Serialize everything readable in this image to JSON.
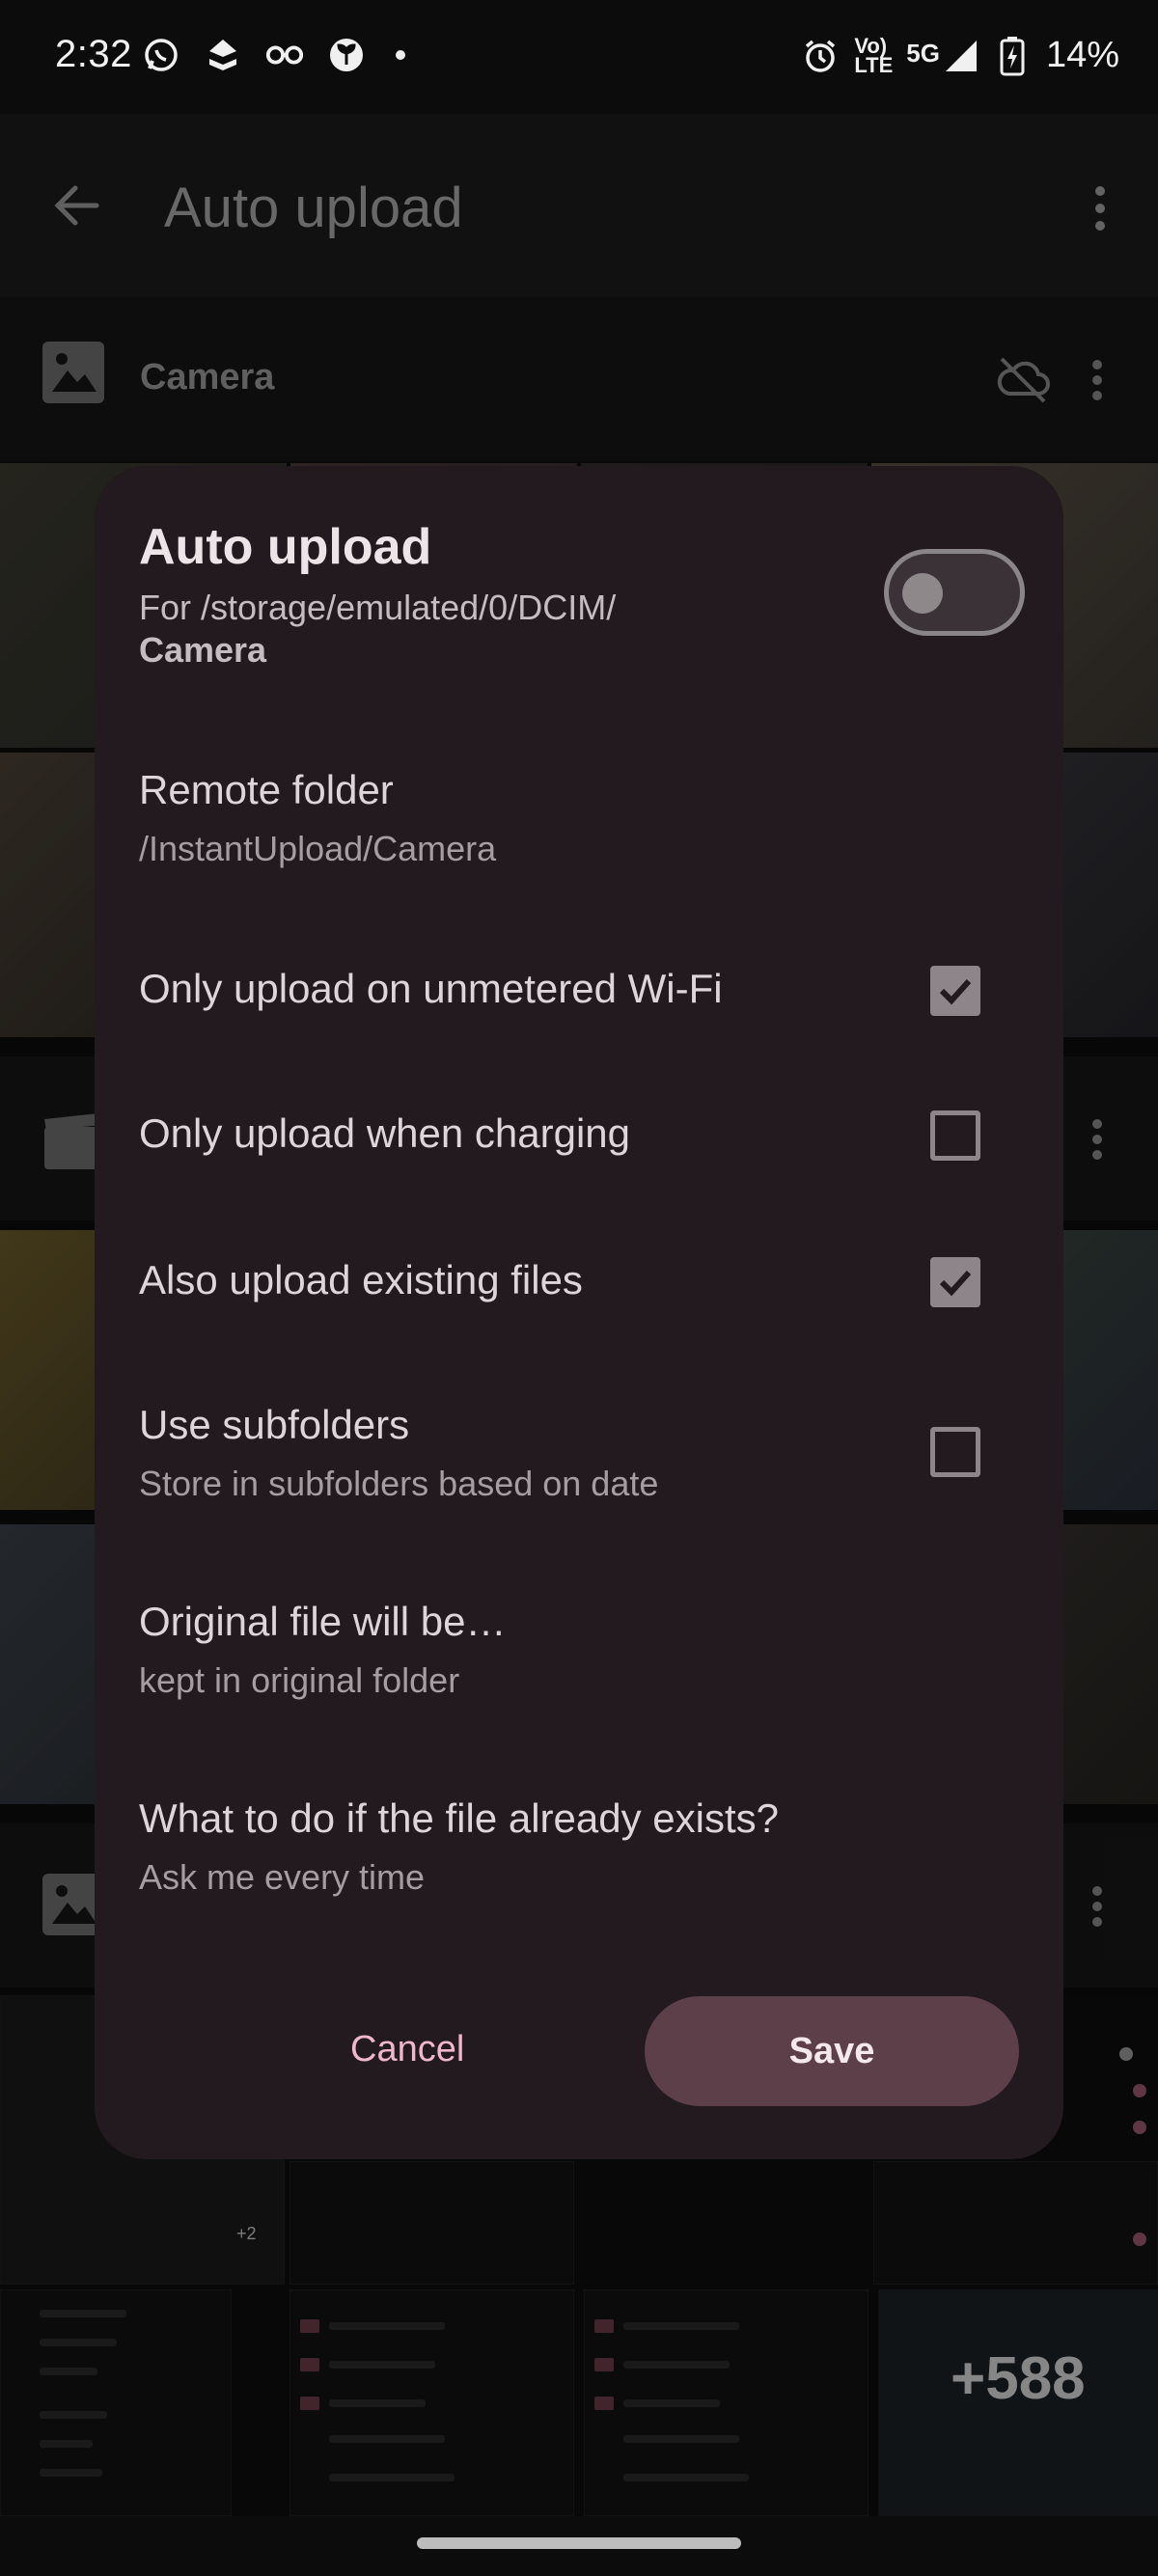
{
  "status_bar": {
    "time": "2:32",
    "network_top": "Vo)",
    "network_bottom": "LTE",
    "network_type": "5G",
    "battery": "14%"
  },
  "app_bar": {
    "title": "Auto upload"
  },
  "folders": {
    "first": "Camera"
  },
  "background_previews": {
    "more_count": "+588",
    "small_more_count": "+2"
  },
  "dialog": {
    "title": "Auto upload",
    "subtitle": "For /storage/emulated/0/DCIM/",
    "subtitle_folder": "Camera",
    "toggle_on": false,
    "remote_folder": {
      "title": "Remote folder",
      "value": "/InstantUpload/Camera"
    },
    "options": [
      {
        "title": "Only upload on unmetered Wi-Fi",
        "checked": true
      },
      {
        "title": "Only upload when charging",
        "checked": false
      },
      {
        "title": "Also upload existing files",
        "checked": true
      },
      {
        "title": "Use subfolders",
        "subtitle": "Store in subfolders based on date",
        "checked": false
      }
    ],
    "original_file": {
      "title": "Original file will be…",
      "value": "kept in original folder"
    },
    "conflict": {
      "title": "What to do if the file already exists?",
      "value": "Ask me every time"
    },
    "cancel_label": "Cancel",
    "save_label": "Save"
  },
  "colors": {
    "dialog_bg": "#221a1e",
    "accent_pink": "#f0b6ca",
    "save_bg": "#5c3f48"
  }
}
